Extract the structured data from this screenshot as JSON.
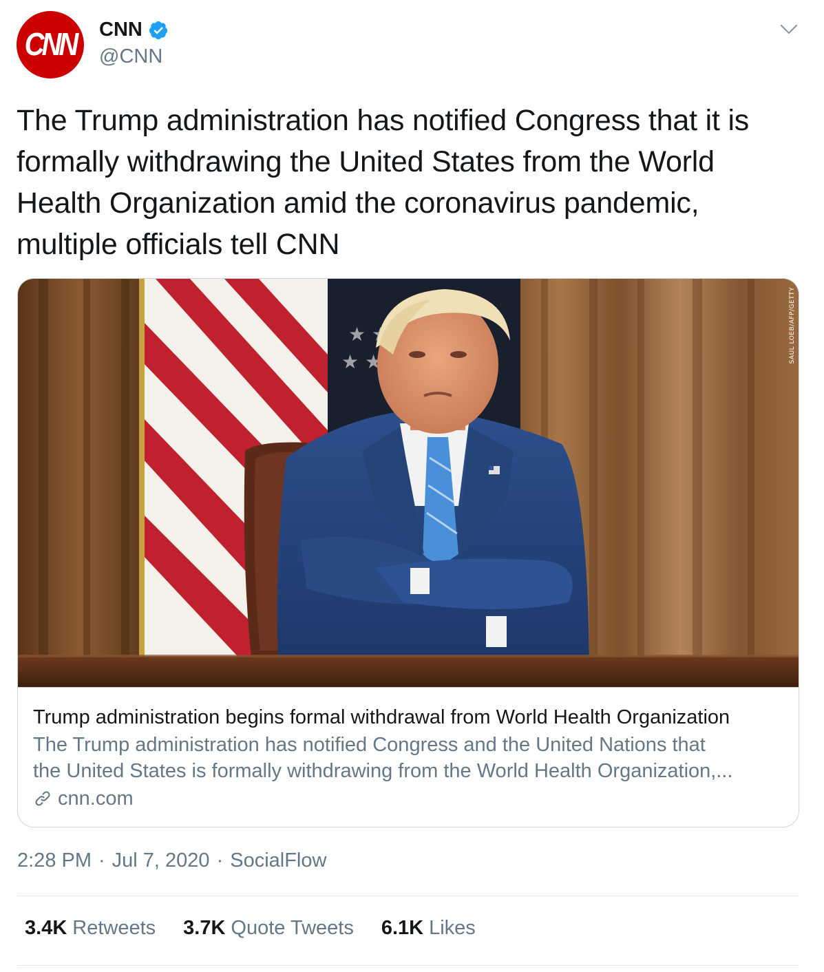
{
  "author": {
    "avatar_text": "CNN",
    "display_name": "CNN",
    "handle": "@CNN",
    "verified": true
  },
  "tweet": {
    "text": "The Trump administration has notified Congress that it is formally withdrawing the United States from the World Health Organization amid the coronavirus pandemic, multiple officials tell CNN"
  },
  "card": {
    "photo_credit": "SAUL LOEB/AFP/GETTY",
    "title": "Trump administration begins formal withdrawal from World Health Organization",
    "description_line1": "The Trump administration has notified Congress and the United Nations that",
    "description_line2": "the United States is formally withdrawing from the World Health Organization,...",
    "domain": "cnn.com"
  },
  "meta": {
    "time": "2:28 PM",
    "separator": "·",
    "date": "Jul 7, 2020",
    "source": "SocialFlow"
  },
  "stats": {
    "retweets_count": "3.4K",
    "retweets_label": "Retweets",
    "quotes_count": "3.7K",
    "quotes_label": "Quote Tweets",
    "likes_count": "6.1K",
    "likes_label": "Likes"
  },
  "colors": {
    "brand_red": "#cc0000",
    "verified_blue": "#1da1f2",
    "secondary_text": "#657786",
    "border": "#ccd6dd"
  },
  "icons": {
    "verified": "verified-badge-icon",
    "chevron": "chevron-down-icon",
    "link": "link-icon"
  }
}
